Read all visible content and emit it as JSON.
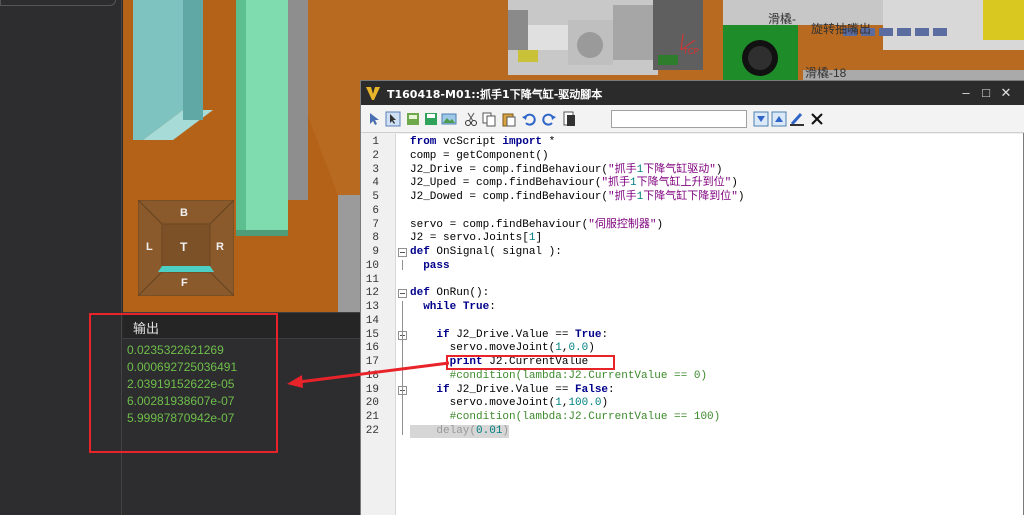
{
  "output": {
    "title": "输出",
    "lines": [
      "0.0235322621269",
      "0.000692725036491",
      "2.03919152622e-05",
      "6.00281938607e-07",
      "5.99987870942e-07"
    ]
  },
  "navcube": {
    "top": "B",
    "left": "L",
    "center": "T",
    "right": "R",
    "bottom": "F"
  },
  "scene_labels": {
    "label1": "滑橇-",
    "label2": "旋转抽嘴出",
    "label3": "滑橇-18",
    "label4": "5",
    "label5": "TCP"
  },
  "window": {
    "title": "T160418-M01::抓手1下降气缸-驱动腳本",
    "search_value": ""
  },
  "code_lines": [
    {
      "n": "1",
      "text": "from vcScript import *"
    },
    {
      "n": "2",
      "text": "comp = getComponent()"
    },
    {
      "n": "3",
      "text": "J2_Drive = comp.findBehaviour(\"抓手1下降气缸驱动\")"
    },
    {
      "n": "4",
      "text": "J2_Uped = comp.findBehaviour(\"抓手1下降气缸上升到位\")"
    },
    {
      "n": "5",
      "text": "J2_Dowed = comp.findBehaviour(\"抓手1下降气缸下降到位\")"
    },
    {
      "n": "6",
      "text": ""
    },
    {
      "n": "7",
      "text": "servo = comp.findBehaviour(\"伺服控制器\")"
    },
    {
      "n": "8",
      "text": "J2 = servo.Joints[1]"
    },
    {
      "n": "9",
      "text": "def OnSignal( signal ):"
    },
    {
      "n": "10",
      "text": "  pass"
    },
    {
      "n": "11",
      "text": ""
    },
    {
      "n": "12",
      "text": "def OnRun():"
    },
    {
      "n": "13",
      "text": "  while True:"
    },
    {
      "n": "14",
      "text": ""
    },
    {
      "n": "15",
      "text": "    if J2_Drive.Value == True:"
    },
    {
      "n": "16",
      "text": "      servo.moveJoint(1,0.0)"
    },
    {
      "n": "17",
      "text": "      print J2.CurrentValue"
    },
    {
      "n": "18",
      "text": "      #condition(lambda:J2.CurrentValue == 0)"
    },
    {
      "n": "19",
      "text": "    if J2_Drive.Value == False:"
    },
    {
      "n": "20",
      "text": "      servo.moveJoint(1,100.0)"
    },
    {
      "n": "21",
      "text": "      #condition(lambda:J2.CurrentValue == 100)"
    },
    {
      "n": "22",
      "text": "    delay(0.01)"
    }
  ],
  "colors": {
    "annotation": "#e8232a",
    "output_text": "#6fbf4a",
    "keyword": "#00008b",
    "string": "#7f007f",
    "comment": "#3d8a2c"
  }
}
